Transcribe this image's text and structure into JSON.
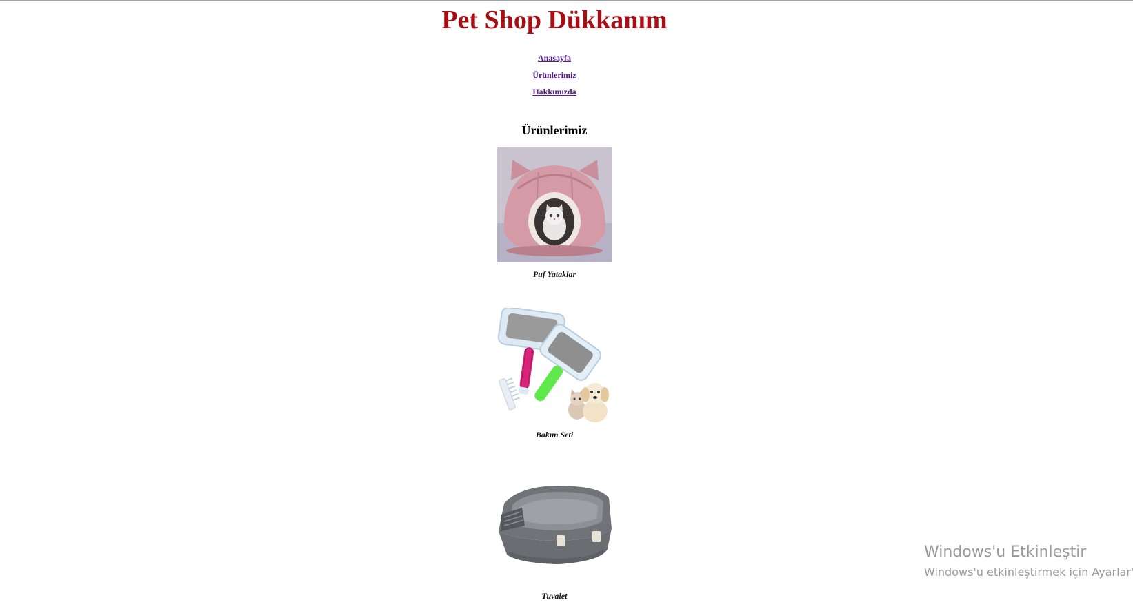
{
  "site": {
    "title": "Pet Shop Dükkanım",
    "title_color": "#a50f15",
    "link_color": "#551a8b"
  },
  "nav": [
    {
      "label": "Anasayfa"
    },
    {
      "label": "Ürünlerimiz"
    },
    {
      "label": "Hakkımızda"
    }
  ],
  "products_section": {
    "heading": "Ürünlerimiz",
    "items": [
      {
        "caption": "Puf Yataklar",
        "image": "pink-cat-bed-image"
      },
      {
        "caption": "Bakım Seti",
        "image": "grooming-brush-set-image"
      },
      {
        "caption": "Tuvalet",
        "image": "gray-litter-box-image"
      }
    ]
  },
  "os_watermark": {
    "line1": "Windows'u Etkinleştir",
    "line2": "Windows'u etkinleştirmek için Ayarlar'a"
  }
}
